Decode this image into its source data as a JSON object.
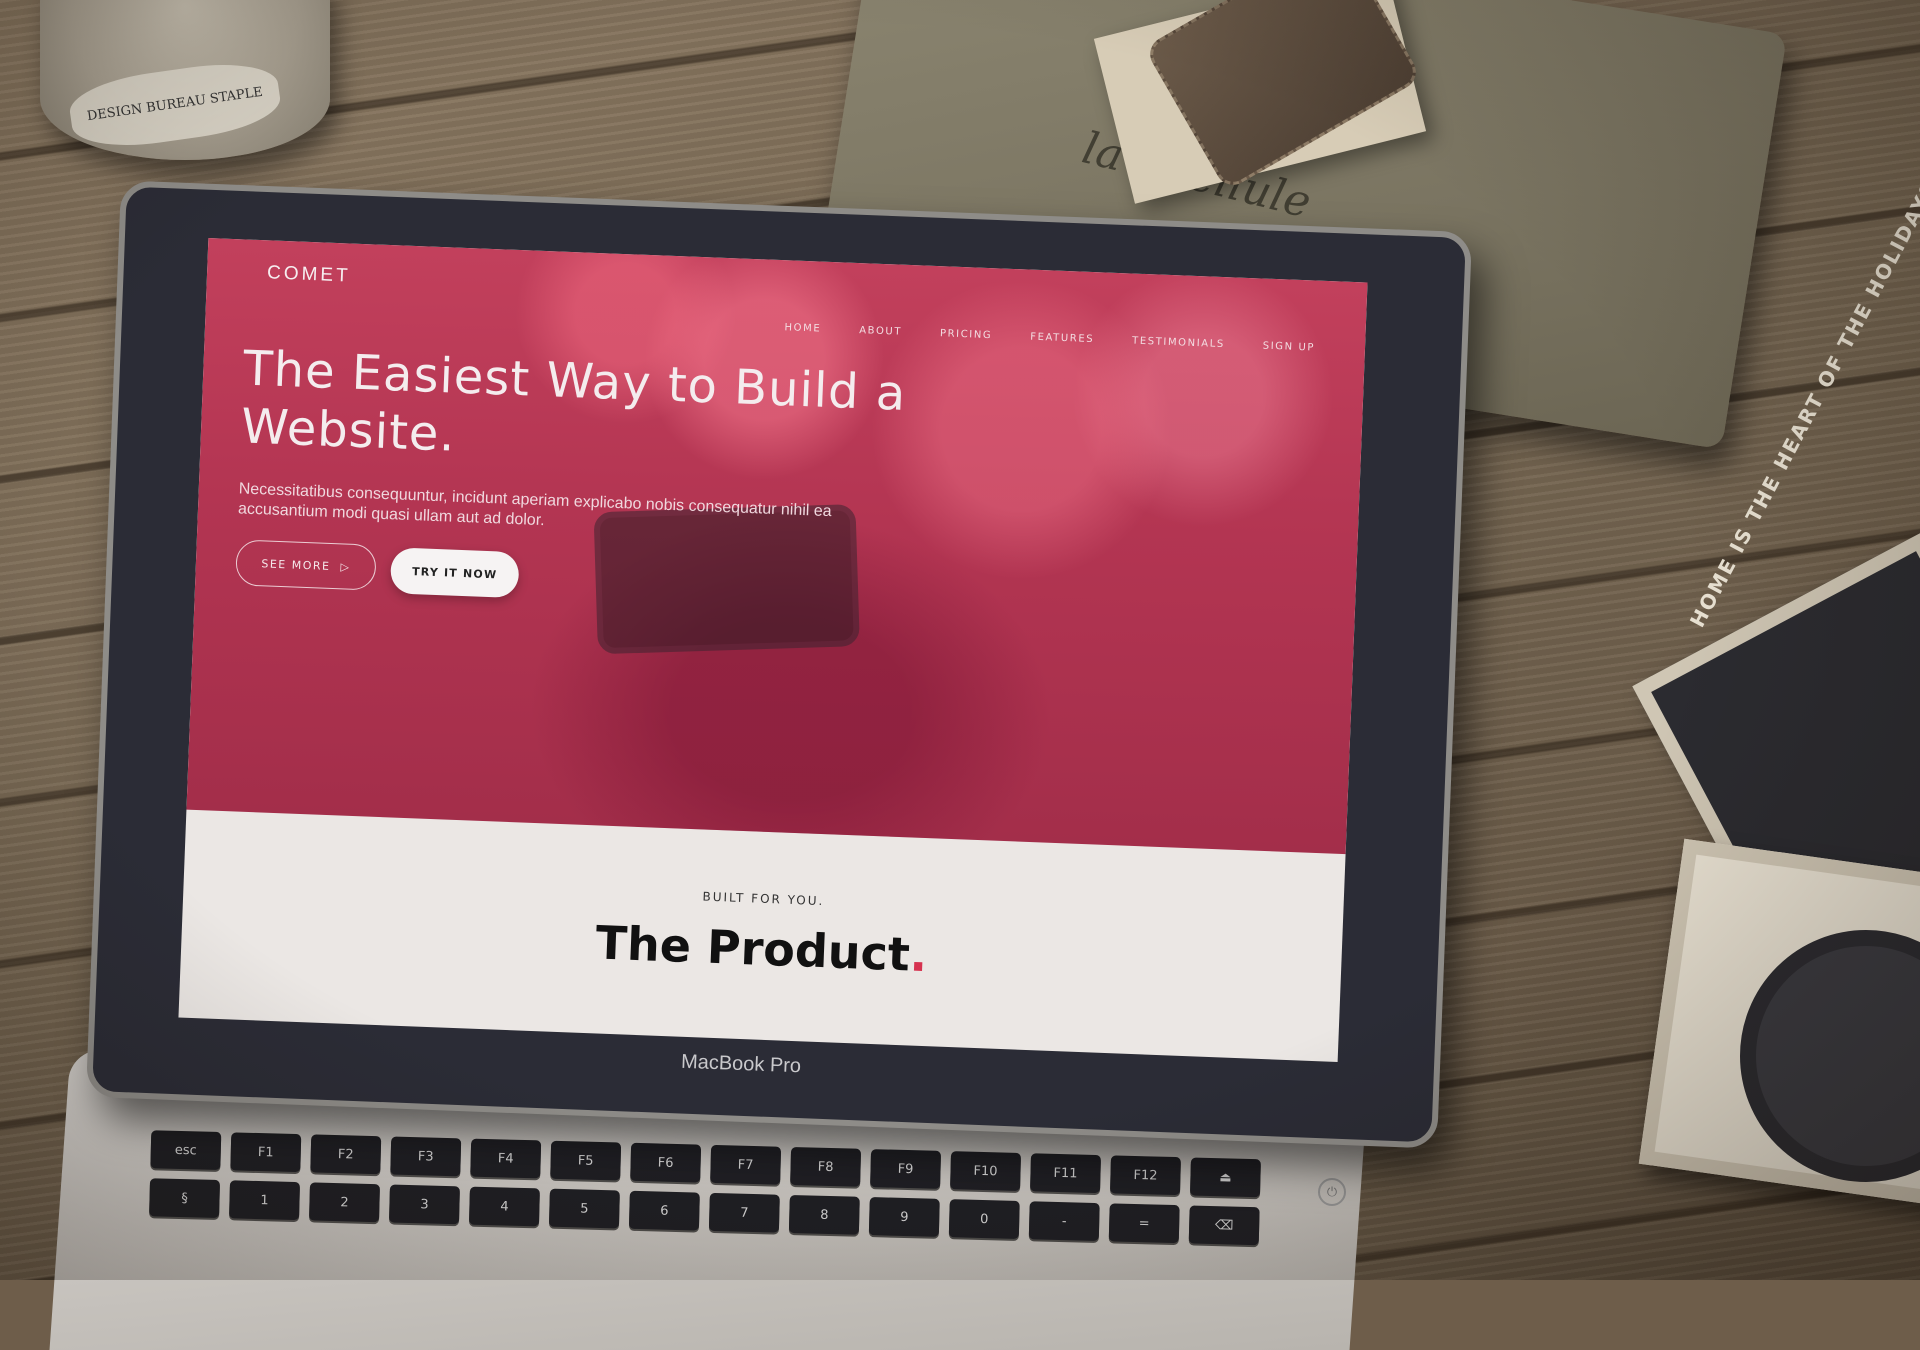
{
  "scene": {
    "jar_label": "DESIGN BUREAU STAPLE",
    "pouch_text": "la libellule",
    "tile_text": "HOME IS THE HEART OF THE HOLIDAYS",
    "laptop_brand": "MacBook Pro"
  },
  "site": {
    "logo": "COMET",
    "nav": [
      "HOME",
      "ABOUT",
      "PRICING",
      "FEATURES",
      "TESTIMONIALS",
      "SIGN UP"
    ],
    "hero": {
      "title": "The Easiest Way to Build a Website.",
      "subtitle": "Necessitatibus consequuntur, incidunt aperiam explicabo nobis consequatur nihil ea accusantium modi quasi ullam aut ad dolor.",
      "see_more_label": "SEE MORE",
      "see_more_icon": "▷",
      "try_label": "TRY IT NOW"
    },
    "section": {
      "eyebrow": "BUILT FOR YOU.",
      "title": "The Product",
      "title_dot": "."
    },
    "colors": {
      "hero_accent": "#b33552",
      "dot": "#d6324f"
    }
  },
  "keyboard": {
    "row1": [
      "esc",
      "F1",
      "F2",
      "F3",
      "F4",
      "F5",
      "F6",
      "F7",
      "F8",
      "F9",
      "F10",
      "F11",
      "F12",
      "⏏"
    ],
    "row2": [
      "§",
      "1",
      "2",
      "3",
      "4",
      "5",
      "6",
      "7",
      "8",
      "9",
      "0",
      "-",
      "=",
      "⌫"
    ]
  },
  "power_icon": "⏻"
}
